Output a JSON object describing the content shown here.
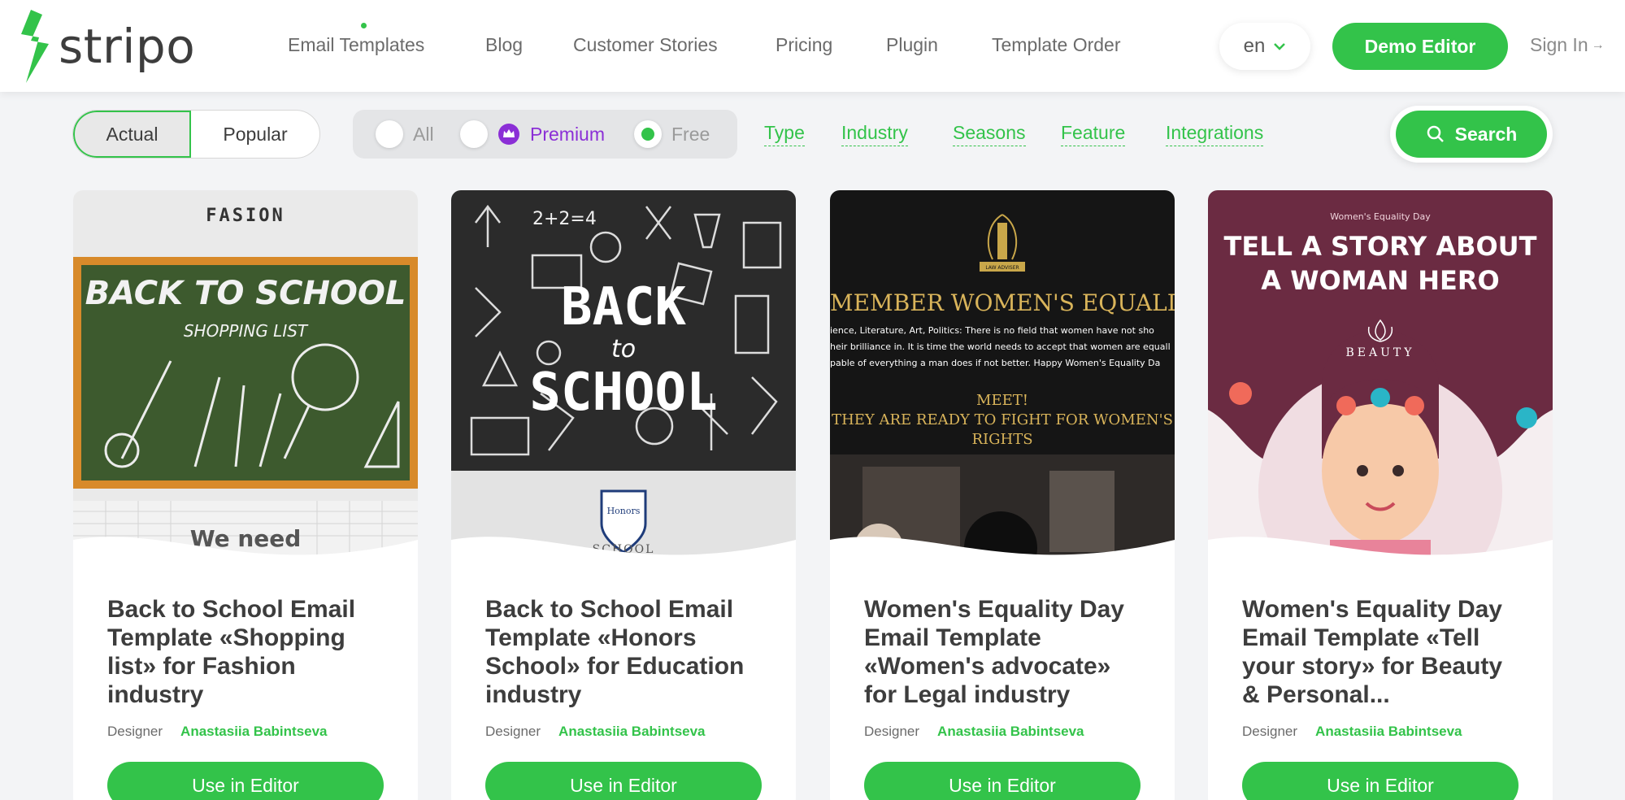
{
  "header": {
    "logo_text": "stripo",
    "nav": [
      {
        "label": "Email Templates"
      },
      {
        "label": "Blog"
      },
      {
        "label": "Customer Stories"
      },
      {
        "label": "Pricing"
      },
      {
        "label": "Plugin"
      },
      {
        "label": "Template Order"
      }
    ],
    "language": "en",
    "demo_button": "Demo Editor",
    "sign_in": "Sign In",
    "accent_color": "#33c34a"
  },
  "filters": {
    "segment": [
      {
        "label": "Actual",
        "active": true
      },
      {
        "label": "Popular",
        "active": false
      }
    ],
    "radios": [
      {
        "label": "All",
        "selected": false
      },
      {
        "label": "Premium",
        "selected": false,
        "icon": "crown-icon"
      },
      {
        "label": "Free",
        "selected": true
      }
    ],
    "links": [
      "Type",
      "Industry",
      "Seasons",
      "Feature",
      "Integrations"
    ],
    "search_label": "Search"
  },
  "cards": [
    {
      "title": "Back to School Email Template «Shopping list» for Fashion industry",
      "designer_label": "Designer",
      "designer_name": "Anastasiia Babintseva",
      "button": "Use in Editor",
      "thumb": {
        "brand": "FASION",
        "headline": "BACK TO SCHOOL",
        "subline": "SHOPPING LIST",
        "footer": "We need"
      }
    },
    {
      "title": "Back to School Email Template «Honors School» for Education industry",
      "designer_label": "Designer",
      "designer_name": "Anastasiia Babintseva",
      "button": "Use in Editor",
      "thumb": {
        "formula": "2+2=4",
        "line1": "BACK",
        "line2": "to",
        "line3": "SCHOOL",
        "badge_top": "Honors",
        "badge_bottom": "SCHOOL"
      }
    },
    {
      "title": "Women's Equality Day Email Template «Women's advocate» for Legal industry",
      "designer_label": "Designer",
      "designer_name": "Anastasiia Babintseva",
      "button": "Use in Editor",
      "thumb": {
        "emblem": "LAW ADVISER",
        "headline": "EMEMBER WOMEN'S EQUALIT",
        "body1": "ience, Literature, Art, Politics: There is no field that women have not sho",
        "body2": "heir brilliance in. It is time the world needs to accept that women are equall",
        "body3": "pable of everything a man does if not better. Happy Women's Equality Da",
        "cta1": "MEET!",
        "cta2": "THEY ARE READY TO FIGHT FOR WOMEN'S",
        "cta3": "RIGHTS"
      }
    },
    {
      "title": "Women's Equality Day Email Template «Tell your story» for Beauty & Personal...",
      "designer_label": "Designer",
      "designer_name": "Anastasiia Babintseva",
      "button": "Use in Editor",
      "thumb": {
        "small": "Women's Equality Day",
        "line1": "TELL A STORY ABOUT",
        "line2": "A WOMAN HERO",
        "brand": "BEAUTY"
      }
    }
  ]
}
